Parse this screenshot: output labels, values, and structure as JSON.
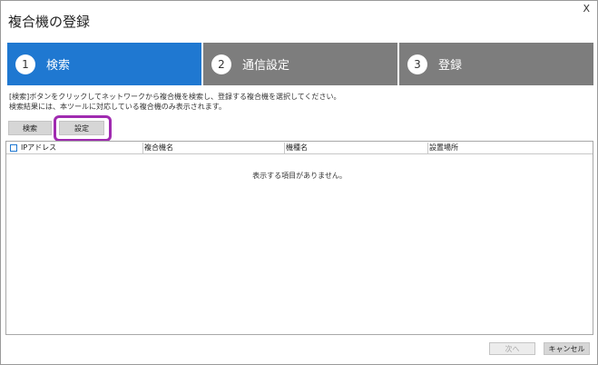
{
  "window": {
    "title": "複合機の登録",
    "close_label": "X"
  },
  "steps": [
    {
      "number": "1",
      "label": "検索",
      "active": true
    },
    {
      "number": "2",
      "label": "通信設定",
      "active": false
    },
    {
      "number": "3",
      "label": "登録",
      "active": false
    }
  ],
  "description": {
    "line1": "[検索]ボタンをクリックしてネットワークから複合機を検索し、登録する複合機を選択してください。",
    "line2": "検索結果には、本ツールに対応している複合機のみ表示されます。"
  },
  "toolbar": {
    "search_label": "検索",
    "settings_label": "設定"
  },
  "table": {
    "columns": [
      "IPアドレス",
      "複合機名",
      "機種名",
      "設置場所"
    ],
    "empty_message": "表示する項目がありません。"
  },
  "footer": {
    "next_label": "次へ",
    "cancel_label": "キャンセル"
  },
  "colors": {
    "active_step": "#1f78d1",
    "inactive_step": "#7d7d7d",
    "highlight": "#a02bb0"
  }
}
